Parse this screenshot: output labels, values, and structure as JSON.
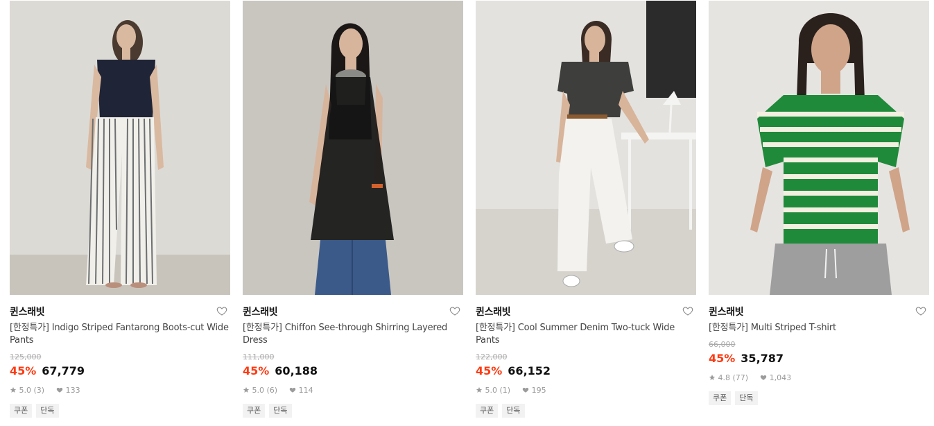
{
  "products": [
    {
      "brand": "퀸스래빗",
      "title": "[한정특가] Indigo Striped Fantarong Boots-cut Wide Pants",
      "original_price": "125,000",
      "discount": "45%",
      "price": "67,779",
      "rating": "5.0 (3)",
      "likes": "133",
      "tags": [
        "쿠폰",
        "단독"
      ]
    },
    {
      "brand": "퀸스래빗",
      "title": "[한정특가] Chiffon See-through Shirring Layered Dress",
      "original_price": "111,000",
      "discount": "45%",
      "price": "60,188",
      "rating": "5.0 (6)",
      "likes": "114",
      "tags": [
        "쿠폰",
        "단독"
      ]
    },
    {
      "brand": "퀸스래빗",
      "title": "[한정특가] Cool Summer Denim Two-tuck Wide Pants",
      "original_price": "122,000",
      "discount": "45%",
      "price": "66,152",
      "rating": "5.0 (1)",
      "likes": "195",
      "tags": [
        "쿠폰",
        "단독"
      ]
    },
    {
      "brand": "퀸스래빗",
      "title": "[한정특가] Multi Striped T-shirt",
      "original_price": "66,000",
      "discount": "45%",
      "price": "35,787",
      "rating": "4.8 (77)",
      "likes": "1,043",
      "tags": [
        "쿠폰",
        "단독"
      ]
    }
  ],
  "icons": {
    "wishlist": "heart-outline-icon",
    "rating": "star-icon",
    "likes": "heart-filled-icon"
  },
  "colors": {
    "discount": "#ff3a12",
    "price": "#111111",
    "tag_bg": "#f2f2f2"
  }
}
